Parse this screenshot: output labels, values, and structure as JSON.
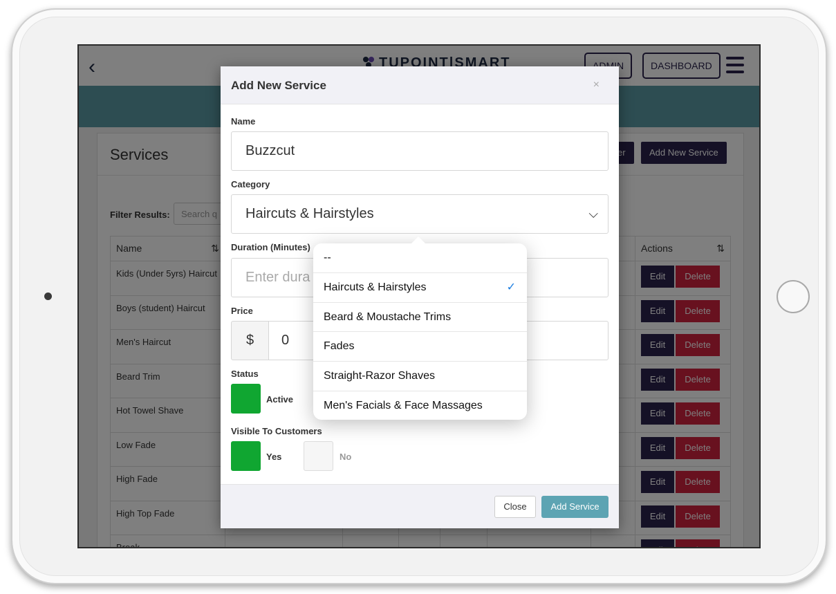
{
  "header": {
    "logo": "TUPOINT|SMART",
    "admin_label": "ADMIN",
    "dashboard_label": "DASHBOARD"
  },
  "page": {
    "title": "Services",
    "other_button": "er",
    "add_service_button": "Add New Service",
    "filter_label": "Filter Results:",
    "search_placeholder": "Search q",
    "columns": [
      "Name",
      "Actions"
    ],
    "rows": [
      "Kids (Under 5yrs) Haircut",
      "Boys (student) Haircut",
      "Men's Haircut",
      "Beard Trim",
      "Hot Towel Shave",
      "Low Fade",
      "High Fade",
      "High Top Fade",
      "Break"
    ],
    "edit_label": "Edit",
    "delete_label": "Delete"
  },
  "modal": {
    "title": "Add New Service",
    "close_x": "×",
    "name_label": "Name",
    "name_value": "Buzzcut",
    "category_label": "Category",
    "category_value": "Haircuts & Hairstyles",
    "duration_label": "Duration (Minutes)",
    "duration_placeholder": "Enter dura",
    "price_label": "Price",
    "price_prefix": "$",
    "price_value": "0",
    "status_label": "Status",
    "status_active": "Active",
    "visible_label": "Visible To Customers",
    "visible_yes": "Yes",
    "visible_no": "No",
    "close_button": "Close",
    "add_button": "Add Service"
  },
  "category_dropdown": {
    "options": [
      "--",
      "Haircuts & Hairstyles",
      "Beard & Moustache Trims",
      "Fades",
      "Straight-Razor Shaves",
      "Men's Facials & Face Massages"
    ],
    "selected": "Haircuts & Hairstyles"
  },
  "colors": {
    "primary_dark": "#2b234d",
    "teal": "#5a9aa5",
    "delete_red": "#d0223f",
    "active_green": "#10a631",
    "add_button": "#5da4b3"
  }
}
